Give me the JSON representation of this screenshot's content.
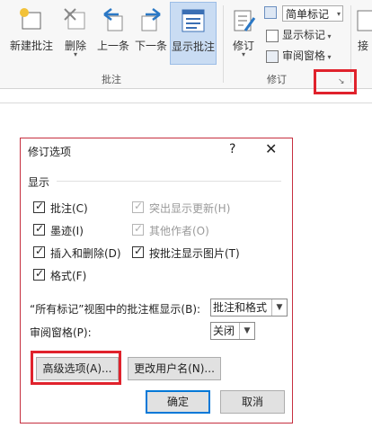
{
  "ribbon": {
    "buttons": [
      {
        "label": "新建批注",
        "icon": "new-comment-icon"
      },
      {
        "label": "删除",
        "icon": "delete-comment-icon"
      },
      {
        "label": "上一条",
        "icon": "previous-arrow-icon"
      },
      {
        "label": "下一条",
        "icon": "next-arrow-icon"
      },
      {
        "label": "显示批注",
        "icon": "show-comments-icon"
      },
      {
        "label": "修订",
        "icon": "track-changes-icon"
      }
    ],
    "group_comments": "批注",
    "group_tracking": "修订",
    "markup_combo": "简单标记",
    "show_markup": "显示标记",
    "reviewing_pane": "审阅窗格",
    "accept_partial": "接"
  },
  "dialog": {
    "title": "修订选项",
    "help": "?",
    "close": "✕",
    "section": "显示",
    "checkboxes": [
      {
        "label": "批注(C)",
        "checked": true,
        "enabled": true
      },
      {
        "label": "突出显示更新(H)",
        "checked": true,
        "enabled": false
      },
      {
        "label": "墨迹(I)",
        "checked": true,
        "enabled": true
      },
      {
        "label": "其他作者(O)",
        "checked": true,
        "enabled": false
      },
      {
        "label": "插入和删除(D)",
        "checked": true,
        "enabled": true
      },
      {
        "label": "按批注显示图片(T)",
        "checked": true,
        "enabled": true
      },
      {
        "label": "格式(F)",
        "checked": true,
        "enabled": true
      }
    ],
    "balloons_label": "“所有标记”视图中的批注框显示(B):",
    "balloons_value": "批注和格式",
    "pane_label": "审阅窗格(P):",
    "pane_value": "关闭",
    "advanced_button": "高级选项(A)...",
    "username_button": "更改用户名(N)...",
    "ok_button": "确定",
    "cancel_button": "取消"
  },
  "colors": {
    "highlight": "#e0222c",
    "accent": "#0078d7"
  }
}
